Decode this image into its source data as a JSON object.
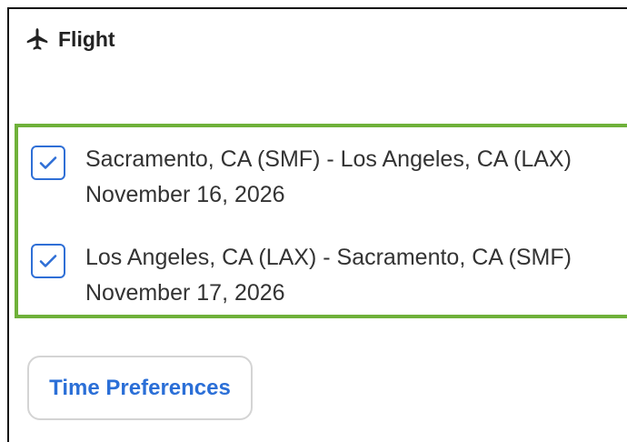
{
  "section": {
    "title": "Flight",
    "icon": "airplane-icon"
  },
  "legs": [
    {
      "route": "Sacramento, CA (SMF) - Los Angeles, CA (LAX)",
      "date": "November 16, 2026",
      "checked": true
    },
    {
      "route": "Los Angeles, CA (LAX) - Sacramento, CA (SMF)",
      "date": "November 17, 2026",
      "checked": true
    }
  ],
  "actions": {
    "time_preferences_label": "Time Preferences"
  },
  "colors": {
    "highlight_border": "#6fb13a",
    "checkbox_accent": "#2f6fd6",
    "button_text": "#2b6fd7",
    "text": "#333333"
  }
}
